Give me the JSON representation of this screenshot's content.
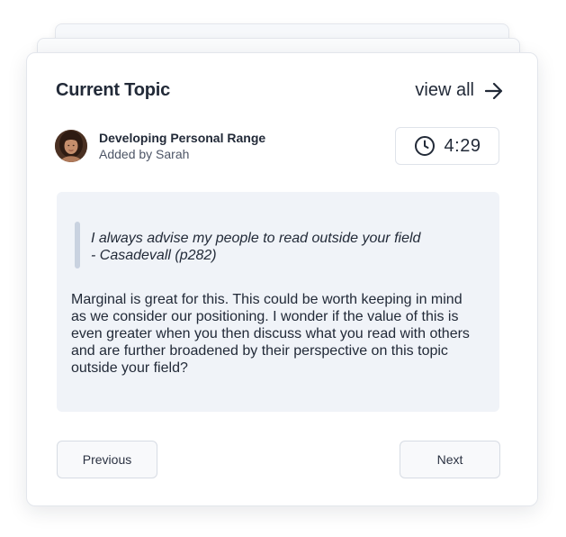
{
  "card": {
    "title": "Current Topic",
    "view_all_label": "view all",
    "view_all_icon": "arrow-right-icon"
  },
  "topic": {
    "name": "Developing Personal Range",
    "added_by": "Added by Sarah",
    "avatar_icon": "avatar-photo"
  },
  "timer": {
    "icon": "clock-icon",
    "value": "4:29"
  },
  "content": {
    "quote_line1": "I always advise my people to read outside your field",
    "quote_line2": "- Casadevall (p282)",
    "body": "Marginal is great for this. This could be worth keeping in mind as we consider our positioning. I wonder if the value of this is even greater when you then discuss what you read with others and are further broadened by their perspective on this topic outside your field?"
  },
  "nav": {
    "previous_label": "Previous",
    "next_label": "Next"
  },
  "colors": {
    "text": "#222a38",
    "content_bg": "#f0f3f8",
    "quote_bar": "#c9d2e0",
    "border": "#e3e6ec"
  }
}
